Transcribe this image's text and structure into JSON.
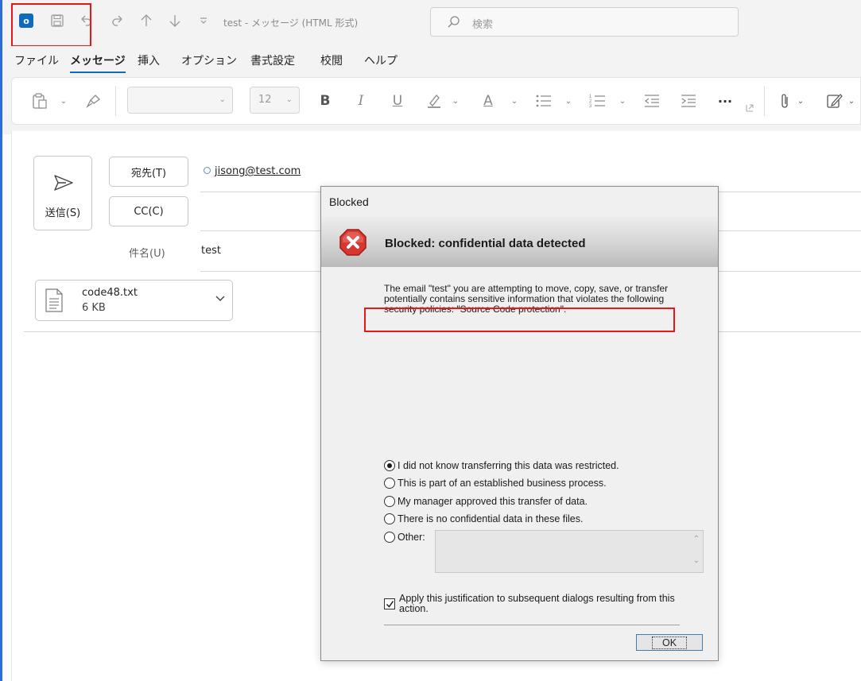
{
  "window": {
    "title": "test - メッセージ (HTML 形式)",
    "search_placeholder": "検索"
  },
  "ribbon_tabs": [
    {
      "label": "ファイル"
    },
    {
      "label": "メッセージ"
    },
    {
      "label": "挿入"
    },
    {
      "label": "オプション"
    },
    {
      "label": "書式設定"
    },
    {
      "label": "校閲"
    },
    {
      "label": "ヘルプ"
    }
  ],
  "toolbar": {
    "font_size": "12",
    "bold": "B",
    "italic": "I",
    "underline": "U",
    "font_color": "A",
    "more": "···"
  },
  "compose": {
    "send_label": "送信(S)",
    "to_label": "宛先(T)",
    "cc_label": "CC(C)",
    "recipient": "jisong@test.com",
    "subject_label": "件名(U)",
    "subject_value": "test"
  },
  "attachment": {
    "name": "code48.txt",
    "size": "6 KB"
  },
  "dialog": {
    "title": "Blocked",
    "header": "Blocked: confidential data detected",
    "message": "The email \"test\" you are attempting to move, copy, save, or transfer potentially contains sensitive information that violates the following security policies: \"Source Code protection\".",
    "options": [
      {
        "label": "I did not know transferring this data was restricted.",
        "selected": true
      },
      {
        "label": "This is part of an established business process.",
        "selected": false
      },
      {
        "label": "My manager approved this transfer of data.",
        "selected": false
      },
      {
        "label": "There is no confidential data in these files.",
        "selected": false
      },
      {
        "label": "Other:",
        "selected": false
      }
    ],
    "apply_checkbox": {
      "label": "Apply this justification to subsequent dialogs resulting from this action.",
      "checked": true
    },
    "ok_label": "OK"
  },
  "colors": {
    "accent": "#0f6cbd",
    "highlight": "#e81818"
  }
}
